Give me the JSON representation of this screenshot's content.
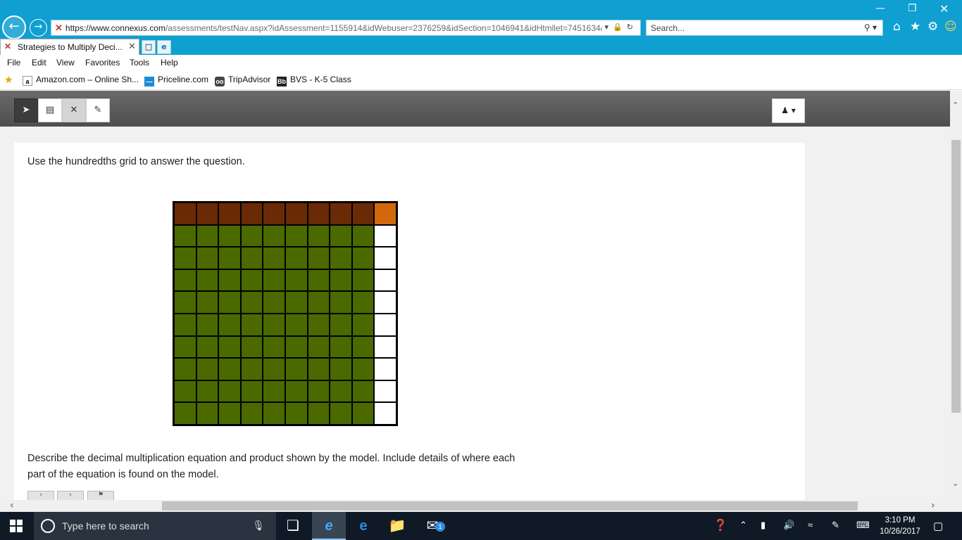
{
  "browser": {
    "url_host": "https://www.connexus.com",
    "url_path": "/assessments/testNav.aspx?idAssessment=1155914&idWebuser=2376259&idSection=1046941&idHtmllet=7451634&",
    "search_placeholder": "Search...",
    "tab_title": "Strategies to Multiply Deci...",
    "menu": [
      "File",
      "Edit",
      "View",
      "Favorites",
      "Tools",
      "Help"
    ],
    "favorites": [
      "Amazon.com – Online Sh...",
      "Priceline.com",
      "TripAdvisor",
      "BVS - K-5 Class"
    ]
  },
  "assessment": {
    "prompt": "Use the hundredths grid to answer the question.",
    "question": "Describe the decimal multiplication equation and product shown by the model. Include details of where each part of the equation is found on the model.",
    "grid": {
      "rows": 10,
      "cols": 10,
      "row_colors": {
        "brown": "#6b2a06",
        "orange": "#d2680c",
        "green": "#4a6a00",
        "white": "#ffffff"
      }
    }
  },
  "taskbar": {
    "search_placeholder": "Type here to search",
    "time": "3:10 PM",
    "date": "10/26/2017",
    "mail_badge": "1"
  }
}
